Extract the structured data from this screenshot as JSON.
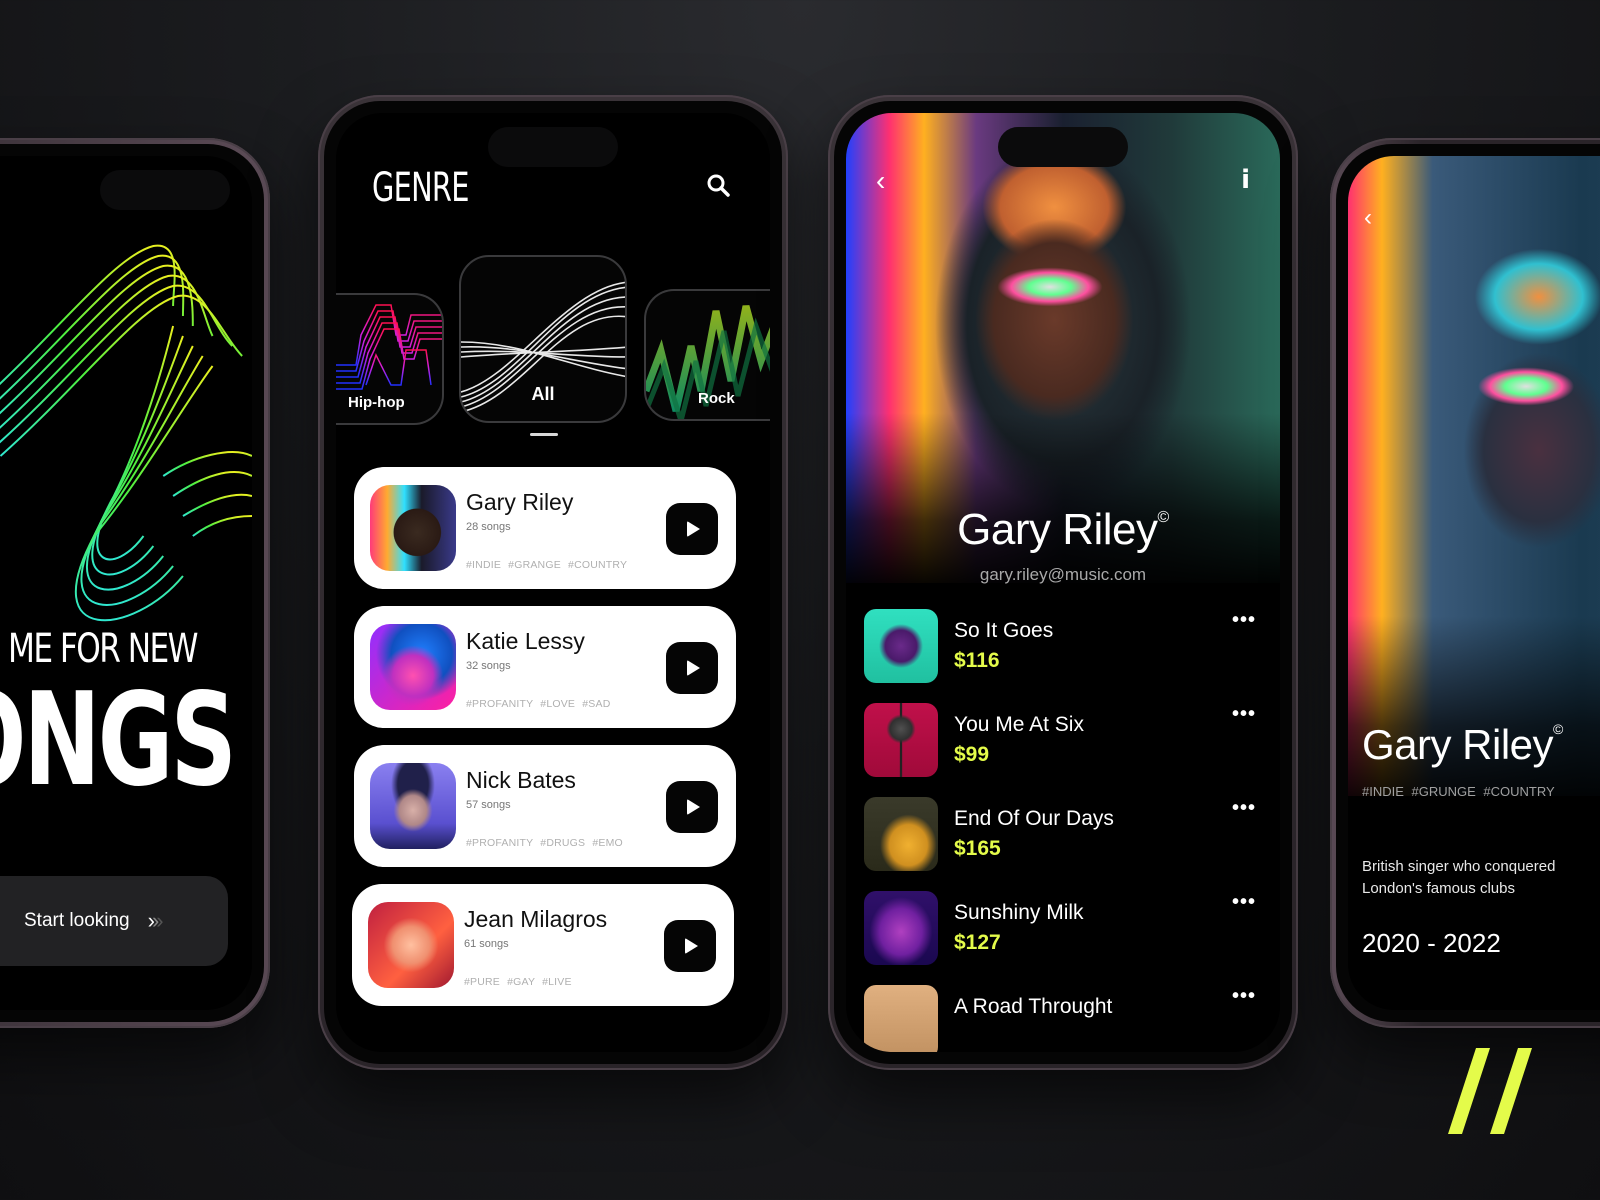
{
  "colors": {
    "accent": "#e4fb4a",
    "background": "#1b1c1f",
    "card": "#ffffff",
    "play_button": "#050505"
  },
  "onboarding": {
    "headline_line1": "ME FOR NEW",
    "headline_line2": "ONGS",
    "start_button_label": "Start looking",
    "start_button_icon": "triple-chevron-right"
  },
  "genre_screen": {
    "title": "GENRE",
    "search_icon": "search-icon",
    "genres": [
      {
        "label": "Hip-hop",
        "selected": false
      },
      {
        "label": "All",
        "selected": true
      },
      {
        "label": "Rock",
        "selected": false
      }
    ],
    "artists": [
      {
        "name": "Gary Riley",
        "songs": "28 songs",
        "tags": "#INDIE #GRANGE #COUNTRY"
      },
      {
        "name": "Katie Lessy",
        "songs": "32 songs",
        "tags": "#PROFANITY #LOVE #SAD"
      },
      {
        "name": "Nick Bates",
        "songs": "57 songs",
        "tags": "#PROFANITY #DRUGS #EMO"
      },
      {
        "name": "Jean Milagros",
        "songs": "61 songs",
        "tags": "#PURE #GAY #LIVE"
      }
    ]
  },
  "artist_screen": {
    "back_icon": "chevron-left-icon",
    "info_label": "i",
    "name": "Gary Riley",
    "copyright_mark": "©",
    "email": "gary.riley@music.com",
    "tracks": [
      {
        "title": "So It Goes",
        "price": "$116",
        "more": "•••"
      },
      {
        "title": "You Me At Six",
        "price": "$99",
        "more": "•••"
      },
      {
        "title": "End Of Our Days",
        "price": "$165",
        "more": "•••"
      },
      {
        "title": "Sunshiny Milk",
        "price": "$127",
        "more": "•••"
      },
      {
        "title": "A Road Throught",
        "price": "",
        "more": "•••"
      }
    ]
  },
  "artist_bio_screen": {
    "name": "Gary Riley",
    "copyright_mark": "©",
    "tags": "#INDIE #GRUNGE #COUNTRY",
    "bio": "British singer who conquered London's famous clubs",
    "years": "2020 - 2022"
  }
}
